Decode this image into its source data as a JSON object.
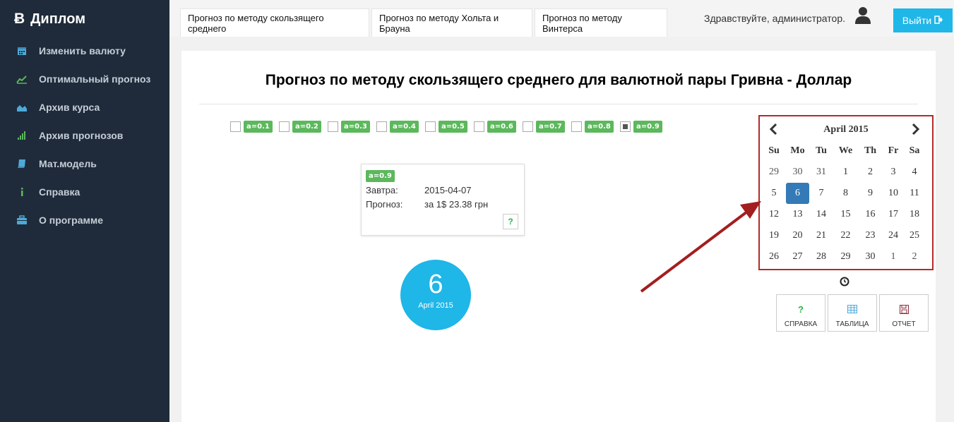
{
  "brand": {
    "title": "Диплом",
    "icon": "bitcoin-icon"
  },
  "sidebar": {
    "items": [
      {
        "label": "Изменить валюту",
        "icon": "calendar-icon"
      },
      {
        "label": "Оптимальный прогноз",
        "icon": "line-chart-icon"
      },
      {
        "label": "Архив курса",
        "icon": "area-chart-icon"
      },
      {
        "label": "Архив прогнозов",
        "icon": "signal-bars-icon"
      },
      {
        "label": "Мат.модель",
        "icon": "book-icon"
      },
      {
        "label": "Справка",
        "icon": "info-icon"
      },
      {
        "label": "О программе",
        "icon": "briefcase-icon"
      }
    ]
  },
  "tabs": [
    "Прогноз по методу скользящего среднего",
    "Прогноз по методу Хольта и Брауна",
    "Прогноз по методу Винтерса"
  ],
  "header": {
    "greeting": "Здравствуйте, администратор.",
    "logout_label": "Выйти"
  },
  "title": {
    "prefix": "Прогноз по методу ",
    "method": "скользящего среднего",
    "middle": " для валютной пары ",
    "pair": "Гривна - Доллар"
  },
  "alphas": [
    {
      "label": "a=0.1",
      "checked": false
    },
    {
      "label": "a=0.2",
      "checked": false
    },
    {
      "label": "a=0.3",
      "checked": false
    },
    {
      "label": "a=0.4",
      "checked": false
    },
    {
      "label": "a=0.5",
      "checked": false
    },
    {
      "label": "a=0.6",
      "checked": false
    },
    {
      "label": "a=0.7",
      "checked": false
    },
    {
      "label": "a=0.8",
      "checked": false
    },
    {
      "label": "a=0.9",
      "checked": true
    }
  ],
  "forecast": {
    "badge": "a=0.9",
    "tomorrow_label": "Завтра:",
    "tomorrow_value": "2015-04-07",
    "forecast_label": "Прогноз:",
    "forecast_value": "за 1$ 23.38 грн",
    "help": "?"
  },
  "date_circle": {
    "day": "6",
    "month": "April 2015"
  },
  "calendar": {
    "month": "April 2015",
    "weekdays": [
      "Su",
      "Mo",
      "Tu",
      "We",
      "Th",
      "Fr",
      "Sa"
    ],
    "days": [
      [
        "29",
        "30",
        "31",
        "1",
        "2",
        "3",
        "4"
      ],
      [
        "5",
        "6",
        "7",
        "8",
        "9",
        "10",
        "11"
      ],
      [
        "12",
        "13",
        "14",
        "15",
        "16",
        "17",
        "18"
      ],
      [
        "19",
        "20",
        "21",
        "22",
        "23",
        "24",
        "25"
      ],
      [
        "26",
        "27",
        "28",
        "29",
        "30",
        "1",
        "2"
      ]
    ],
    "selected": "6"
  },
  "actions": [
    {
      "label": "СПРАВКА",
      "icon": "question-icon"
    },
    {
      "label": "ТАБЛИЦА",
      "icon": "table-icon"
    },
    {
      "label": "ОТЧЕТ",
      "icon": "save-icon"
    }
  ],
  "colors": {
    "sidebar": "#1f2b3a",
    "accent": "#1fb6e8",
    "badge": "#5cb85c",
    "highlight": "#b52a2a",
    "selected": "#337ab7"
  }
}
